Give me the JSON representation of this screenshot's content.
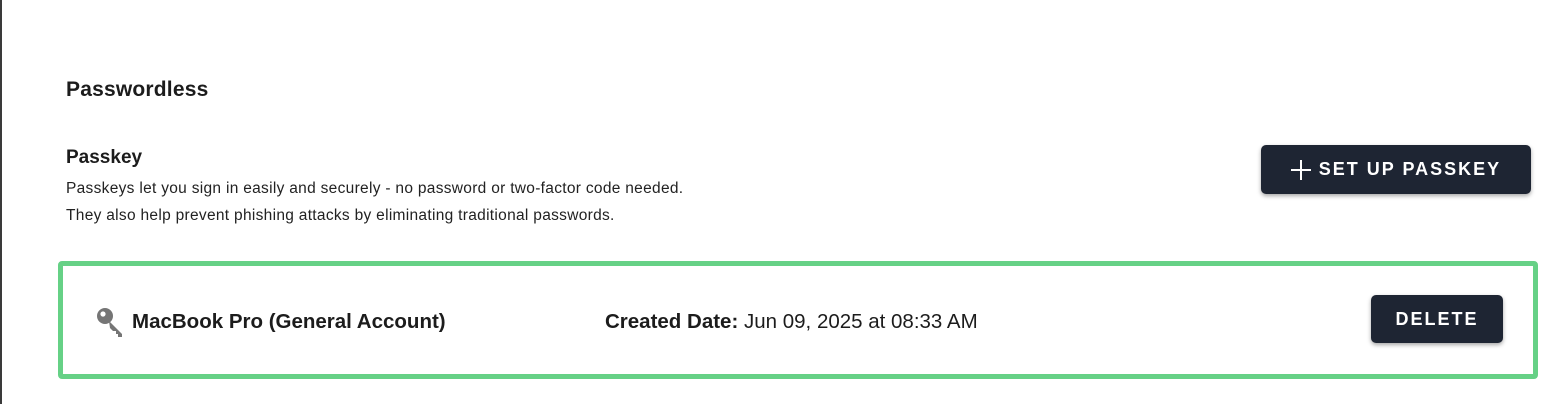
{
  "section": {
    "title": "Passwordless"
  },
  "passkey": {
    "title": "Passkey",
    "description_line1": "Passkeys let you sign in easily and securely - no password or two-factor code needed.",
    "description_line2": "They also help prevent phishing attacks by eliminating traditional passwords.",
    "setup_button": {
      "icon": "plus-icon",
      "label": "SET UP PASSKEY"
    }
  },
  "passkeys_list": [
    {
      "icon": "key-icon",
      "device_name": "MacBook Pro (General Account)",
      "created_label": "Created Date:",
      "created_value": "Jun 09, 2025 at 08:33 AM",
      "delete_label": "DELETE"
    }
  ],
  "colors": {
    "button_bg": "#1e2533",
    "card_highlight_border": "#66d186",
    "icon_gray": "#757575"
  }
}
